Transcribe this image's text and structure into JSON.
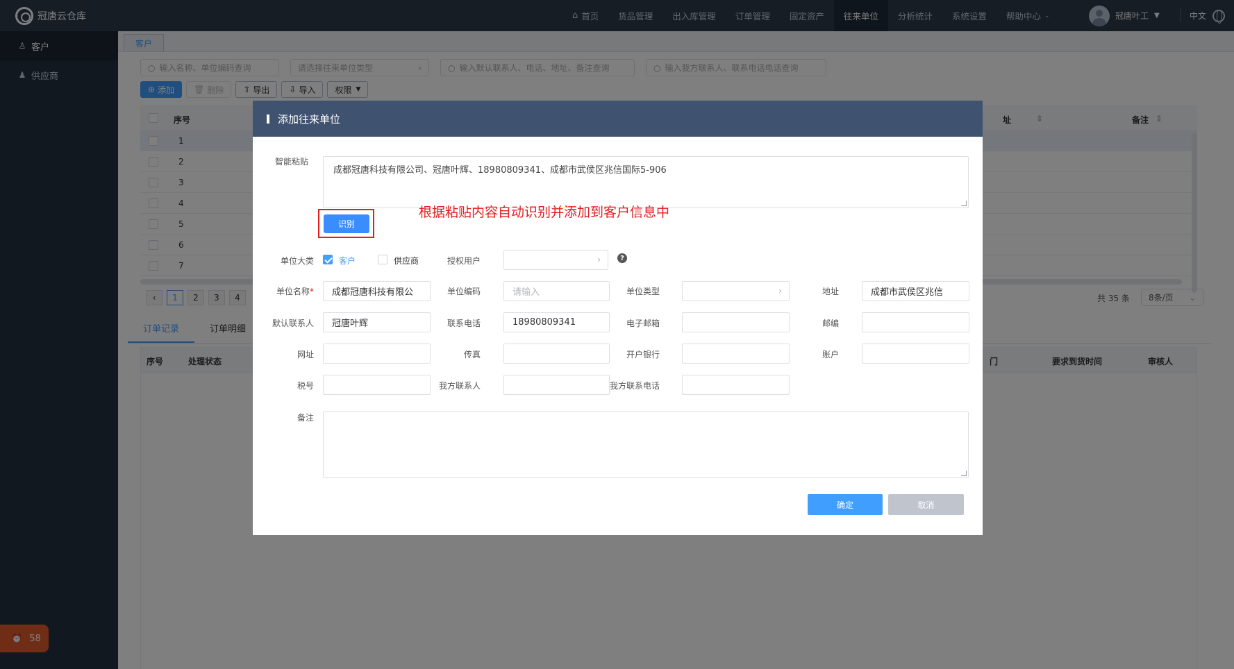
{
  "app": {
    "logo_text": "冠唐云仓库"
  },
  "nav": {
    "items": [
      "首页",
      "货品管理",
      "出入库管理",
      "订单管理",
      "固定资产",
      "往来单位",
      "分析统计",
      "系统设置",
      "帮助中心"
    ],
    "user": "冠唐叶工",
    "lang": "中文"
  },
  "sidebar": {
    "items": [
      "客户",
      "供应商"
    ],
    "badge_count": "58"
  },
  "page": {
    "tab": "客户",
    "filters": {
      "name_code": "输入名称、单位编码查询",
      "type": "请选择往来单位类型",
      "contact": "输入默认联系人、电话、地址、备注查询",
      "our_contact": "输入我方联系人、联系电话电话查询"
    },
    "toolbar": {
      "add": "添加",
      "delete": "删除",
      "export": "导出",
      "import": "导入",
      "perm": "权限"
    },
    "table": {
      "col_seq": "序号",
      "col_addr": "址",
      "col_remark": "备注",
      "rows": [
        "1",
        "2",
        "3",
        "4",
        "5",
        "6",
        "7"
      ]
    },
    "pager": {
      "pages": [
        "1",
        "2",
        "3",
        "4"
      ],
      "total": "共 35 条",
      "size": "8条/页"
    },
    "subtabs": [
      "订单记录",
      "订单明细"
    ],
    "subtable": {
      "seq": "序号",
      "status": "处理状态",
      "dept": "门",
      "due": "要求到货时间",
      "reviewer": "审核人"
    }
  },
  "dialog": {
    "title": "添加往来单位",
    "smart_paste_label": "智能粘贴",
    "smart_paste_value": "成都冠唐科技有限公司、冠唐叶辉、18980809341、成都市武侯区兆信国际5-906",
    "recognize_btn": "识别",
    "annotation": "根据粘贴内容自动识别并添加到客户信息中",
    "category_label": "单位大类",
    "opt_customer": "客户",
    "opt_supplier": "供应商",
    "auth_user_label": "授权用户",
    "name_label": "单位名称",
    "name_value": "成都冠唐科技有限公",
    "code_label": "单位编码",
    "code_placeholder": "请输入",
    "type_label": "单位类型",
    "address_label": "地址",
    "address_value": "成都市武侯区兆信",
    "contact_label": "默认联系人",
    "contact_value": "冠唐叶辉",
    "phone_label": "联系电话",
    "phone_value": "18980809341",
    "email_label": "电子邮箱",
    "zip_label": "邮编",
    "website_label": "网址",
    "fax_label": "传真",
    "bank_label": "开户银行",
    "account_label": "账户",
    "tax_label": "税号",
    "our_contact_label": "我方联系人",
    "our_phone_label": "我方联系电话",
    "remark_label": "备注",
    "ok_btn": "确定",
    "cancel_btn": "取消"
  }
}
